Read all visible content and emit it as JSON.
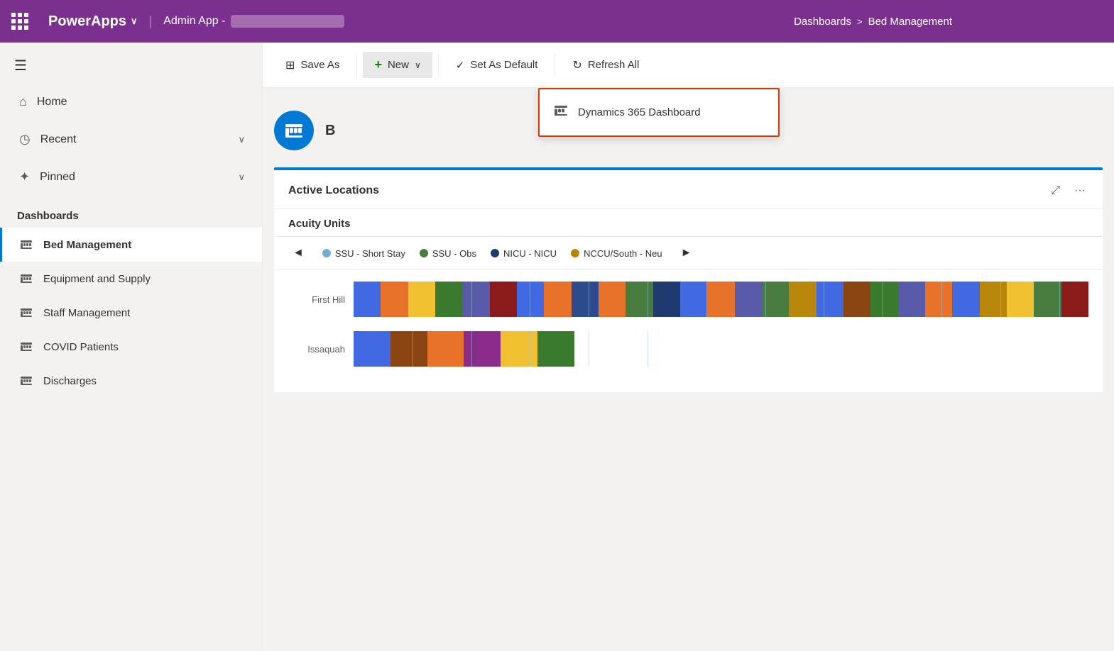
{
  "topNav": {
    "appName": "PowerApps",
    "chevron": "∨",
    "adminApp": "Admin App -",
    "breadcrumb": {
      "part1": "Dashboards",
      "separator": ">",
      "part2": "Bed Management"
    }
  },
  "toolbar": {
    "saveAs": "Save As",
    "new": "New",
    "setAsDefault": "Set As Default",
    "refreshAll": "Refresh All"
  },
  "dropdown": {
    "item": "Dynamics 365 Dashboard"
  },
  "sidebar": {
    "hamburger": "≡",
    "navItems": [
      {
        "id": "home",
        "label": "Home",
        "icon": "⌂"
      },
      {
        "id": "recent",
        "label": "Recent",
        "icon": "◷",
        "hasChevron": true
      },
      {
        "id": "pinned",
        "label": "Pinned",
        "icon": "✦",
        "hasChevron": true
      }
    ],
    "sectionLabel": "Dashboards",
    "dashboardItems": [
      {
        "id": "bed-management",
        "label": "Bed Management",
        "active": true
      },
      {
        "id": "equipment-supply",
        "label": "Equipment and Supply",
        "active": false
      },
      {
        "id": "staff-management",
        "label": "Staff Management",
        "active": false
      },
      {
        "id": "covid-patients",
        "label": "COVID Patients",
        "active": false
      },
      {
        "id": "discharges",
        "label": "Discharges",
        "active": false
      }
    ]
  },
  "chart": {
    "title": "Active Locations",
    "subtitle": "Acuity Units",
    "legend": [
      {
        "label": "SSU - Short Stay",
        "color": "#74afd3"
      },
      {
        "label": "SSU - Obs",
        "color": "#4a7c3f"
      },
      {
        "label": "NICU - NICU",
        "color": "#1f3a6e"
      },
      {
        "label": "NCCU/South - Neu",
        "color": "#b8860b"
      }
    ],
    "rows": [
      {
        "label": "First Hill",
        "segments": [
          "#4169e1",
          "#e8722a",
          "#f0c030",
          "#3a7a2e",
          "#5a5aaa",
          "#8b1a1a",
          "#4169e1",
          "#e8722a",
          "#2c4a8c",
          "#e8722a",
          "#4a7c3f",
          "#1f3a6e",
          "#4169e1",
          "#e8722a",
          "#5a5aaa",
          "#4a7c3f",
          "#b8860b",
          "#4169e1",
          "#8b4513",
          "#3a7a2e",
          "#5a5aaa",
          "#e8722a",
          "#4169e1",
          "#b8860b",
          "#f0c030",
          "#4a7c3f",
          "#8b1a1a"
        ]
      },
      {
        "label": "Issaquah",
        "segments": [
          "#4169e1",
          "#8b4513",
          "#e8722a",
          "#8b2c8b",
          "#f0c030",
          "#3a7a2e"
        ]
      }
    ]
  }
}
